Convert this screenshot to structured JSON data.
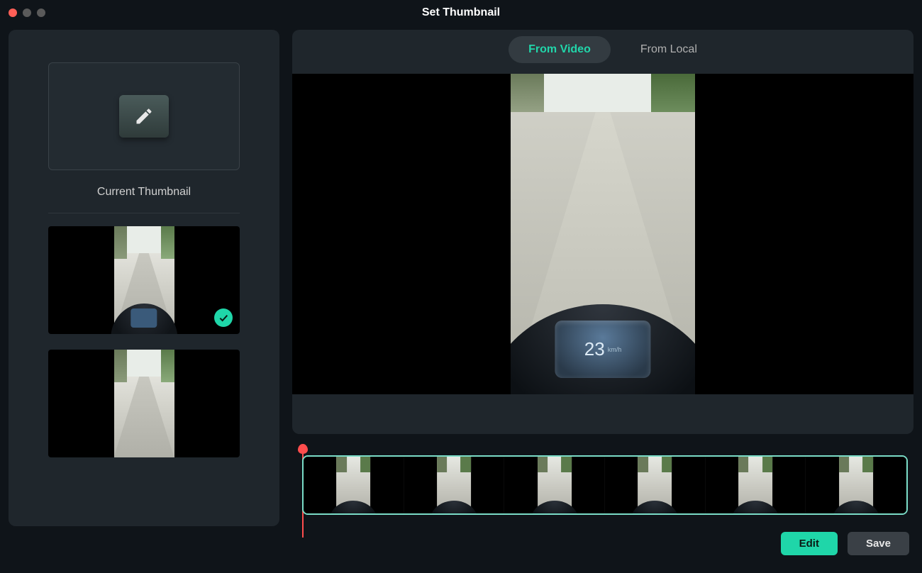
{
  "window": {
    "title": "Set Thumbnail"
  },
  "sidebar": {
    "current_label": "Current Thumbnail",
    "options": [
      {
        "selected": true
      },
      {
        "selected": false
      }
    ]
  },
  "tabs": {
    "from_video": "From Video",
    "from_local": "From Local",
    "active": "from_video"
  },
  "preview": {
    "speed_value": "23",
    "speed_unit": "km/h"
  },
  "timeline": {
    "frame_count": 6,
    "playhead_position": 0
  },
  "actions": {
    "edit": "Edit",
    "save": "Save"
  },
  "colors": {
    "accent": "#1fd6a9",
    "playhead": "#ff4d4d",
    "panel": "#1f262c",
    "background": "#0f1419"
  }
}
